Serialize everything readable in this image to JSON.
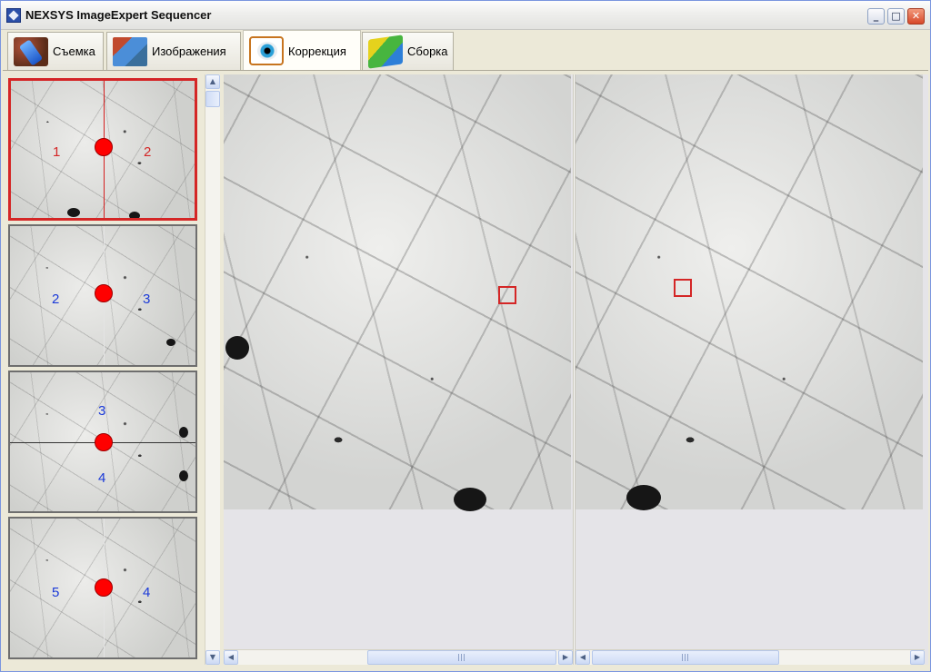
{
  "window": {
    "title": "NEXSYS ImageExpert Sequencer"
  },
  "tabs": [
    {
      "label": "Съемка",
      "icon": "camera-icon"
    },
    {
      "label": "Изображения",
      "icon": "images-icon"
    },
    {
      "label": "Коррекция",
      "icon": "eye-icon",
      "active": true
    },
    {
      "label": "Сборка",
      "icon": "cube-icon"
    }
  ],
  "thumbnails": [
    {
      "left_label": "1",
      "right_label": "2",
      "orientation": "vertical",
      "selected": true,
      "label_color": "#d42626"
    },
    {
      "left_label": "2",
      "right_label": "3",
      "orientation": "vertical",
      "selected": false,
      "label_color": "#1a39d8"
    },
    {
      "left_label": "3",
      "right_label": "4",
      "orientation": "horizontal",
      "selected": false,
      "label_color": "#1a39d8"
    },
    {
      "left_label": "5",
      "right_label": "4",
      "orientation": "vertical",
      "selected": false,
      "label_color": "#1a39d8"
    }
  ],
  "viewers": {
    "left": {
      "scroll_grip": "III"
    },
    "right": {
      "scroll_grip": "III"
    }
  },
  "colors": {
    "accent_red": "#d42626",
    "label_blue": "#1a39d8"
  }
}
